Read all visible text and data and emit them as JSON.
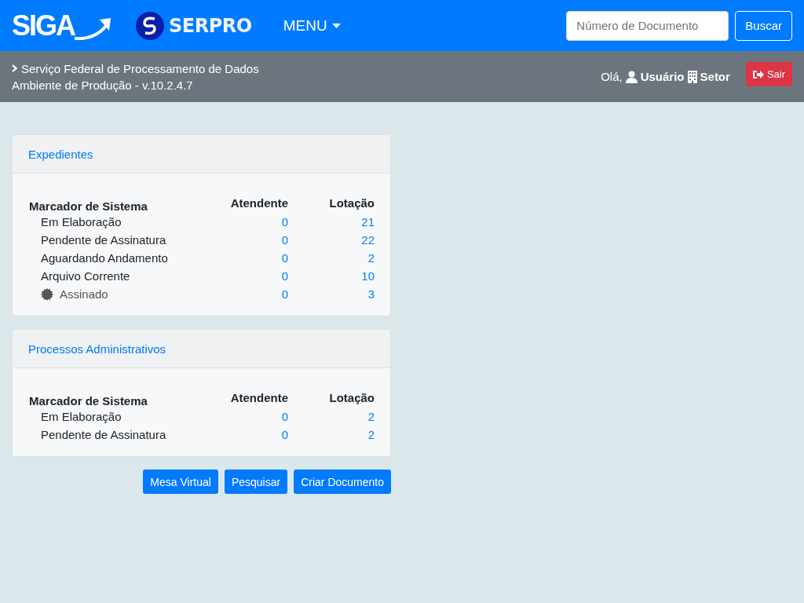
{
  "navbar": {
    "logo_text": "SIGA",
    "brand_text": "SERPRO",
    "menu_label": "MENU",
    "search": {
      "placeholder": "Número de Documento"
    },
    "search_button": "Buscar"
  },
  "subbar": {
    "organization": "Serviço Federal de Processamento de Dados",
    "environment": "Ambiente de Produção - v.10.2.4.7",
    "greeting": "Olá,",
    "user": "Usuário",
    "sector": "Setor",
    "logout_button": "Sair"
  },
  "cards": [
    {
      "title": "Expedientes",
      "columns": [
        "Marcador de Sistema",
        "Atendente",
        "Lotação"
      ],
      "rows": [
        {
          "kind": "plain",
          "label": "Em Elaboração",
          "atendente": "0",
          "lotacao": "21"
        },
        {
          "kind": "plain",
          "label": "Pendente de Assinatura",
          "atendente": "0",
          "lotacao": "22"
        },
        {
          "kind": "plain",
          "label": "Aguardando Andamento",
          "atendente": "0",
          "lotacao": "2"
        },
        {
          "kind": "plain",
          "label": "Arquivo Corrente",
          "atendente": "0",
          "lotacao": "10"
        },
        {
          "kind": "signed",
          "label": "Assinado",
          "atendente": "0",
          "lotacao": "3"
        }
      ]
    },
    {
      "title": "Processos Administrativos",
      "columns": [
        "Marcador de Sistema",
        "Atendente",
        "Lotação"
      ],
      "rows": [
        {
          "kind": "plain",
          "label": "Em Elaboração",
          "atendente": "0",
          "lotacao": "2"
        },
        {
          "kind": "plain",
          "label": "Pendente de Assinatura",
          "atendente": "0",
          "lotacao": "2"
        }
      ]
    }
  ],
  "actions": [
    "Mesa Virtual",
    "Pesquisar",
    "Criar Documento"
  ]
}
